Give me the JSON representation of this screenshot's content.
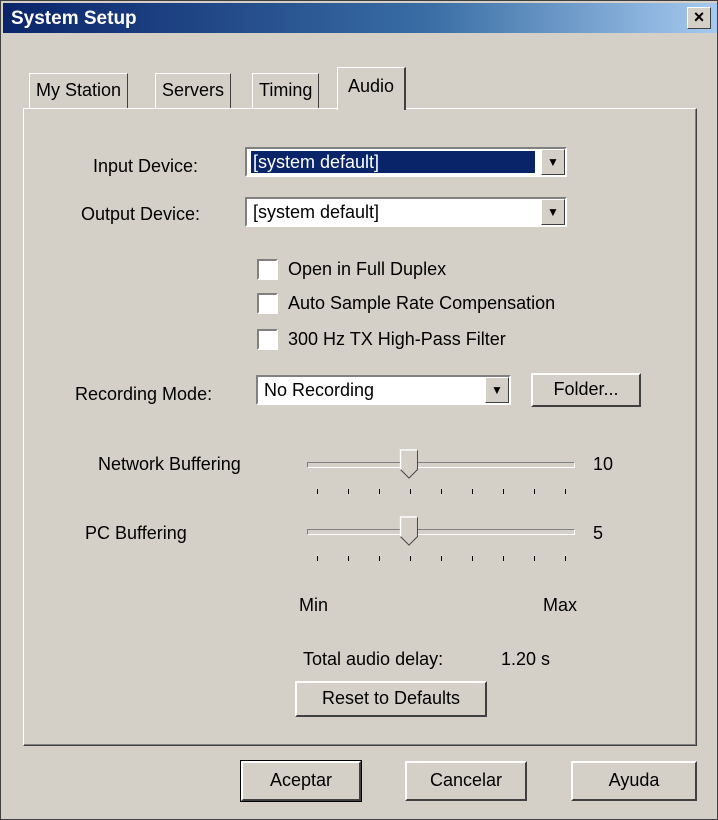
{
  "window": {
    "title": "System Setup",
    "close_glyph": "×"
  },
  "tabs": [
    {
      "label": "My Station",
      "active": false
    },
    {
      "label": "Servers",
      "active": false
    },
    {
      "label": "Timing",
      "active": false
    },
    {
      "label": "Audio",
      "active": true
    }
  ],
  "audio": {
    "input_device_label": "Input Device:",
    "input_device_value": "[system default]",
    "output_device_label": "Output Device:",
    "output_device_value": "[system default]",
    "checkboxes": [
      {
        "label": "Open in Full Duplex",
        "checked": false
      },
      {
        "label": "Auto Sample Rate Compensation",
        "checked": false
      },
      {
        "label": "300 Hz TX High-Pass Filter",
        "checked": false
      }
    ],
    "recording_mode_label": "Recording Mode:",
    "recording_mode_value": "No Recording",
    "folder_button": "Folder...",
    "network_buffering": {
      "label": "Network Buffering",
      "value": "10",
      "position": 0.375
    },
    "pc_buffering": {
      "label": "PC Buffering",
      "value": "5",
      "position": 0.375
    },
    "slider_min": "Min",
    "slider_max": "Max",
    "total_delay_label": "Total audio delay:",
    "total_delay_value": "1.20 s",
    "reset_button": "Reset to Defaults"
  },
  "footer": {
    "ok": "Aceptar",
    "cancel": "Cancelar",
    "help": "Ayuda"
  },
  "colors": {
    "titlebar": "#0a246a",
    "face": "#d4d0c8",
    "selection": "#0a246a"
  }
}
